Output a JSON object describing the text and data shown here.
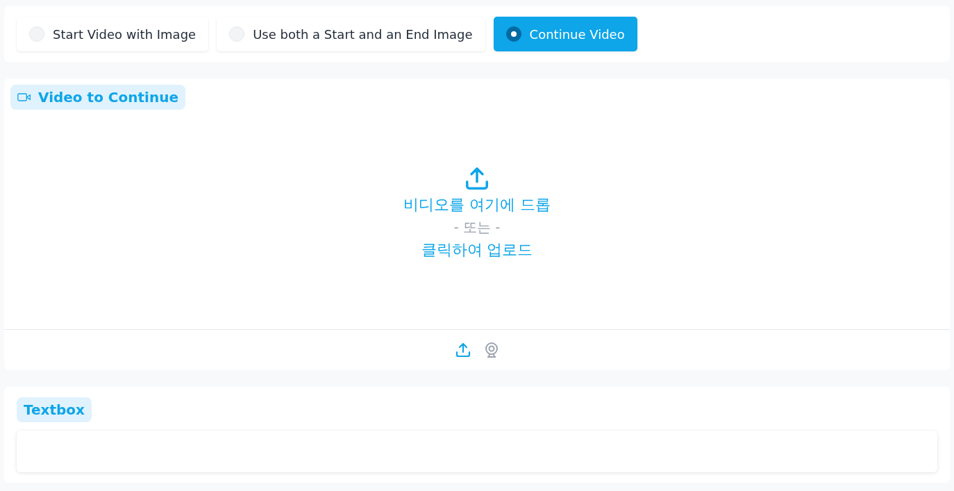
{
  "mode_options": [
    {
      "label": "Start Video with Image",
      "selected": false
    },
    {
      "label": "Use both a Start and an End Image",
      "selected": false
    },
    {
      "label": "Continue Video",
      "selected": true
    }
  ],
  "video_upload": {
    "label": "Video to Continue",
    "drop_text": "비디오를 여기에 드롭",
    "or_text": "- 또는 -",
    "click_text": "클릭하여 업로드"
  },
  "textbox": {
    "label": "Textbox"
  }
}
